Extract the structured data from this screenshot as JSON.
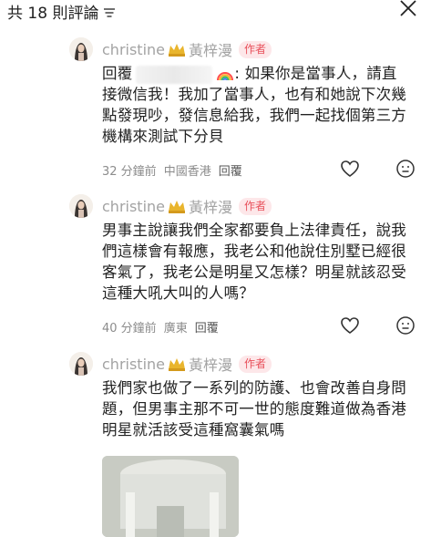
{
  "header": {
    "title": "共 18 則評論"
  },
  "comments": [
    {
      "author": "christine",
      "author_suffix": "黃梓漫",
      "badge": "作者",
      "reply_prefix": "回覆",
      "reply_colon": ":",
      "text_first": " 如果你是當事人，請",
      "text_rest": "直接微信我！我加了當事人，也有和她說下次幾點發現吵，發信息給我，我們一起找個第三方機構來測試下分貝",
      "time": "32 分鐘前",
      "location": "中國香港",
      "reply_label": "回覆"
    },
    {
      "author": "christine",
      "author_suffix": "黃梓漫",
      "badge": "作者",
      "text": "男事主說讓我們全家都要負上法律責任，說我們這樣會有報應，我老公和他說住別墅已經很客氣了，我老公是明星又怎樣？明星就該忍受這種大吼大叫的人嗎？",
      "time": "40 分鐘前",
      "location": "廣東",
      "reply_label": "回覆"
    },
    {
      "author": "christine",
      "author_suffix": "黃梓漫",
      "badge": "作者",
      "text": "我們家也做了一系列的防護、也會改善自身問題，但男事主那不可一世的態度難道做為香港明星就活該受這種窩囊氣嗎"
    }
  ],
  "icons": {
    "close": "close-icon",
    "sort": "sort-icon",
    "like": "heart-icon",
    "dislike": "neutral-face-icon",
    "crown": "crown-icon"
  },
  "colors": {
    "badge_text": "#e8505b",
    "badge_bg": "#fde7e9",
    "meta": "#8c8c8c",
    "name": "#a3a3a3"
  }
}
